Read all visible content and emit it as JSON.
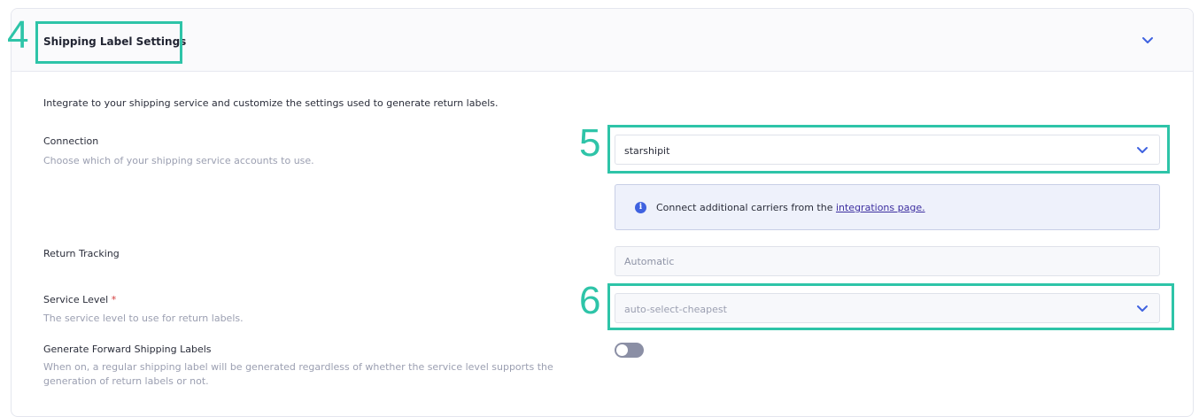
{
  "header": {
    "title": "Shipping Label Settings"
  },
  "intro": "Integrate to your shipping service and customize the settings used to generate return labels.",
  "connection": {
    "label": "Connection",
    "help": "Choose which of your shipping service accounts to use.",
    "value": "starshipit"
  },
  "info": {
    "text": "Connect additional carriers from the ",
    "link": "integrations page."
  },
  "return_tracking": {
    "label": "Return Tracking",
    "value": "Automatic"
  },
  "service_level": {
    "label": "Service Level",
    "required_mark": "*",
    "help": "The service level to use for return labels.",
    "value": "auto-select-cheapest"
  },
  "forward_labels": {
    "label": "Generate Forward Shipping Labels",
    "help": "When on, a regular shipping label will be generated regardless of whether the service level supports the generation of return labels or not.",
    "enabled": false
  },
  "annotations": {
    "a4": "4",
    "a5": "5",
    "a6": "6"
  },
  "colors": {
    "annotation": "#2ec4a8",
    "accent": "#3f62e0",
    "link": "#3d2fa0"
  }
}
